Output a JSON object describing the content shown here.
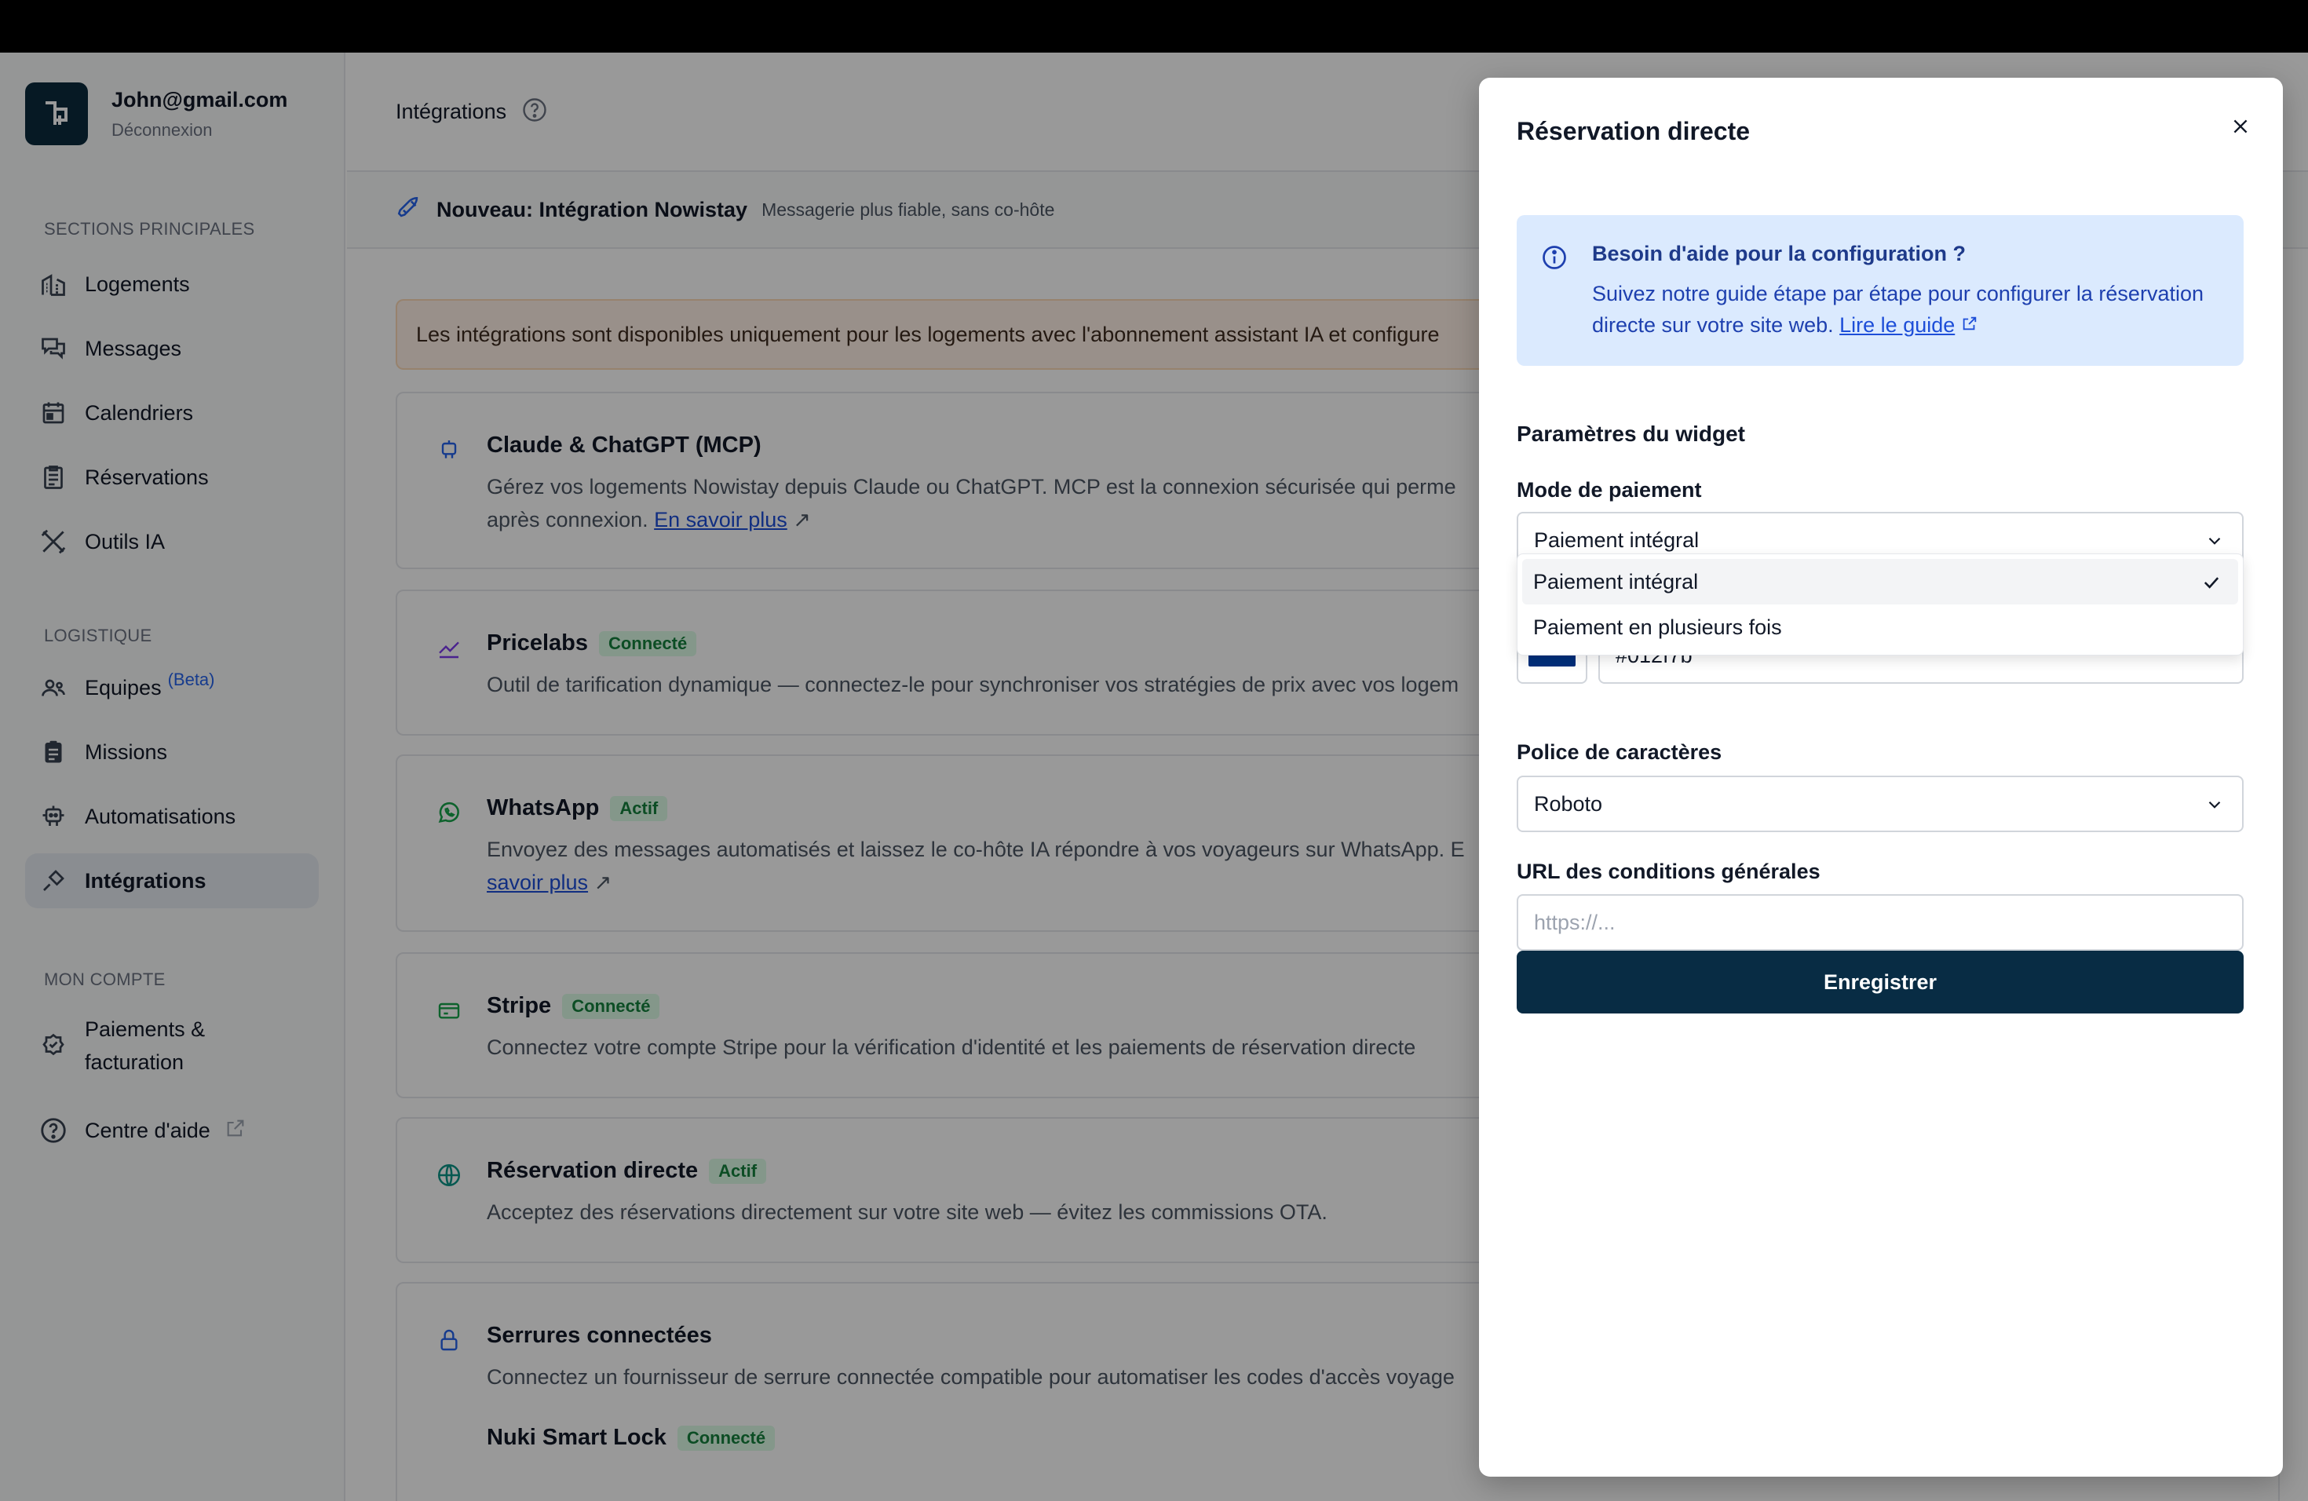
{
  "user": {
    "email": "John@gmail.com",
    "logout": "Déconnexion"
  },
  "sidebar": {
    "sections": [
      {
        "title": "SECTIONS PRINCIPALES"
      },
      {
        "title": "LOGISTIQUE"
      },
      {
        "title": "MON COMPTE"
      }
    ],
    "items": [
      {
        "label": "Logements",
        "icon": "building-icon"
      },
      {
        "label": "Messages",
        "icon": "chat-icon"
      },
      {
        "label": "Calendriers",
        "icon": "calendar-icon"
      },
      {
        "label": "Réservations",
        "icon": "clipboard-icon"
      },
      {
        "label": "Outils IA",
        "icon": "tools-icon"
      },
      {
        "label": "Equipes",
        "icon": "team-icon",
        "badge": "(Beta)"
      },
      {
        "label": "Missions",
        "icon": "clipboard-list-icon"
      },
      {
        "label": "Automatisations",
        "icon": "robot-icon"
      },
      {
        "label": "Intégrations",
        "icon": "plug-icon",
        "active": true
      },
      {
        "label_line1": "Paiements &",
        "label_line2": "facturation",
        "icon": "badge-check-icon"
      },
      {
        "label": "Centre d'aide",
        "icon": "help-circle-icon"
      }
    ]
  },
  "header": {
    "title": "Intégrations"
  },
  "announce": {
    "title": "Nouveau: Intégration Nowistay",
    "subtitle": "Messagerie plus fiable, sans co-hôte"
  },
  "alert": {
    "text": "Les intégrations sont disponibles uniquement pour les logements avec l'abonnement assistant IA et configure"
  },
  "cards": [
    {
      "title": "Claude & ChatGPT (MCP)",
      "badge": "",
      "desc": "Gérez vos logements Nowistay depuis Claude ou ChatGPT. MCP est la connexion sécurisée qui perme",
      "desc2": "après connexion.",
      "link": "En savoir plus"
    },
    {
      "title": "Pricelabs",
      "badge": "Connecté",
      "desc": "Outil de tarification dynamique — connectez-le pour synchroniser vos stratégies de prix avec vos logem"
    },
    {
      "title": "WhatsApp",
      "badge": "Actif",
      "desc": "Envoyez des messages automatisés et laissez le co-hôte IA répondre à vos voyageurs sur WhatsApp. E",
      "link": "savoir plus"
    },
    {
      "title": "Stripe",
      "badge": "Connecté",
      "desc": "Connectez votre compte Stripe pour la vérification d'identité et les paiements de réservation directe"
    },
    {
      "title": "Réservation directe",
      "badge": "Actif",
      "desc": "Acceptez des réservations directement sur votre site web — évitez les commissions OTA."
    },
    {
      "title": "Serrures connectées",
      "badge": "",
      "desc": "Connectez un fournisseur de serrure connectée compatible pour automatiser les codes d'accès voyage"
    },
    {
      "title": "Nuki Smart Lock",
      "badge": "Connecté"
    }
  ],
  "modal": {
    "title": "Réservation directe",
    "info_title": "Besoin d'aide pour la configuration ?",
    "info_text": "Suivez notre guide étape par étape pour configurer la réservation directe sur votre site web.",
    "info_link": "Lire le guide",
    "section_title": "Paramètres du widget",
    "payment_label": "Mode de paiement",
    "payment_value": "Paiement intégral",
    "payment_options": [
      "Paiement intégral",
      "Paiement en plusieurs fois"
    ],
    "color_value": "#012f7b",
    "font_label": "Police de caractères",
    "font_value": "Roboto",
    "terms_label": "URL des conditions générales",
    "terms_placeholder": "https://...",
    "save_label": "Enregistrer"
  },
  "colors": {
    "brand": "#082c44",
    "accent": "#1d4ed8",
    "swatch": "#012f7b"
  }
}
